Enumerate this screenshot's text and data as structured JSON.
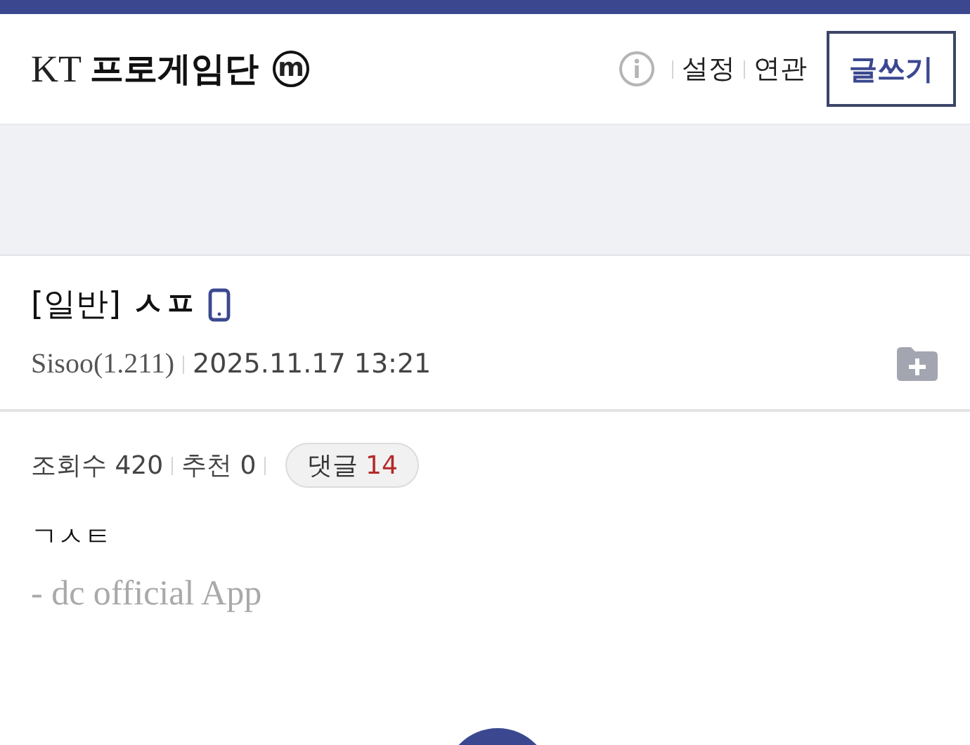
{
  "gallery": {
    "prefix": "KT",
    "name": "프로게임단",
    "badge": "m"
  },
  "header_links": [
    "설정",
    "연관"
  ],
  "write_button": "글쓰기",
  "post": {
    "head": "[일반]",
    "title": "ㅅㅍ",
    "author": "Sisoo(1.211)",
    "date": "2025.11.17 13:21"
  },
  "stats": {
    "views": "조회수 420",
    "recommend": "추천 0",
    "comments_label": "댓글",
    "comments_count": "14"
  },
  "body": "ㄱㅅㅌ",
  "signature": "- dc official App"
}
